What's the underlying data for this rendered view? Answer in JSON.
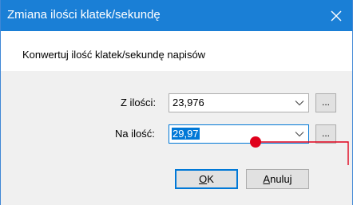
{
  "window": {
    "title": "Zmiana ilości klatek/sekundę"
  },
  "intro_text": "Konwertuj ilość klatek/sekundę napisów",
  "from": {
    "label": "Z ilości:",
    "value": "23,976"
  },
  "to": {
    "label": "Na ilość:",
    "value": "29,97"
  },
  "browse_label": "...",
  "buttons": {
    "ok": {
      "first": "O",
      "rest": "K"
    },
    "cancel": {
      "first": "A",
      "rest": "nuluj"
    }
  },
  "colors": {
    "titlebar": "#1a7fd6",
    "selection": "#0078d7",
    "annotation": "#e0001b"
  }
}
